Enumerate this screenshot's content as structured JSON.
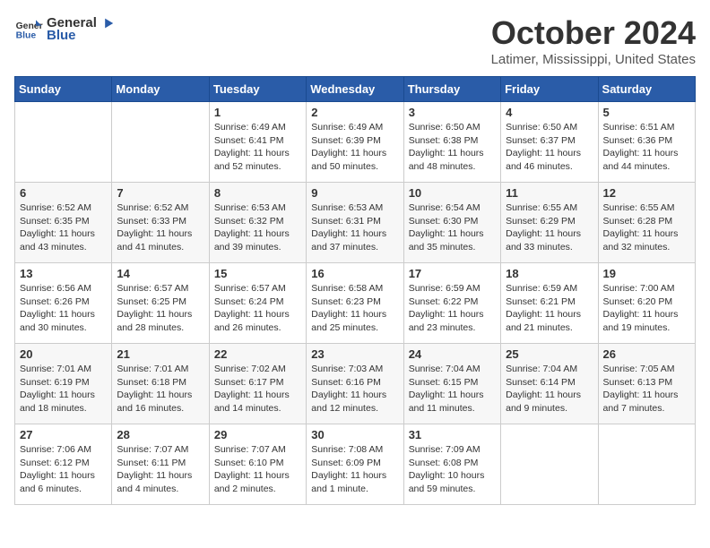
{
  "logo": {
    "general": "General",
    "blue": "Blue"
  },
  "header": {
    "month": "October 2024",
    "location": "Latimer, Mississippi, United States"
  },
  "weekdays": [
    "Sunday",
    "Monday",
    "Tuesday",
    "Wednesday",
    "Thursday",
    "Friday",
    "Saturday"
  ],
  "weeks": [
    [
      {
        "day": "",
        "sunrise": "",
        "sunset": "",
        "daylight": ""
      },
      {
        "day": "",
        "sunrise": "",
        "sunset": "",
        "daylight": ""
      },
      {
        "day": "1",
        "sunrise": "Sunrise: 6:49 AM",
        "sunset": "Sunset: 6:41 PM",
        "daylight": "Daylight: 11 hours and 52 minutes."
      },
      {
        "day": "2",
        "sunrise": "Sunrise: 6:49 AM",
        "sunset": "Sunset: 6:39 PM",
        "daylight": "Daylight: 11 hours and 50 minutes."
      },
      {
        "day": "3",
        "sunrise": "Sunrise: 6:50 AM",
        "sunset": "Sunset: 6:38 PM",
        "daylight": "Daylight: 11 hours and 48 minutes."
      },
      {
        "day": "4",
        "sunrise": "Sunrise: 6:50 AM",
        "sunset": "Sunset: 6:37 PM",
        "daylight": "Daylight: 11 hours and 46 minutes."
      },
      {
        "day": "5",
        "sunrise": "Sunrise: 6:51 AM",
        "sunset": "Sunset: 6:36 PM",
        "daylight": "Daylight: 11 hours and 44 minutes."
      }
    ],
    [
      {
        "day": "6",
        "sunrise": "Sunrise: 6:52 AM",
        "sunset": "Sunset: 6:35 PM",
        "daylight": "Daylight: 11 hours and 43 minutes."
      },
      {
        "day": "7",
        "sunrise": "Sunrise: 6:52 AM",
        "sunset": "Sunset: 6:33 PM",
        "daylight": "Daylight: 11 hours and 41 minutes."
      },
      {
        "day": "8",
        "sunrise": "Sunrise: 6:53 AM",
        "sunset": "Sunset: 6:32 PM",
        "daylight": "Daylight: 11 hours and 39 minutes."
      },
      {
        "day": "9",
        "sunrise": "Sunrise: 6:53 AM",
        "sunset": "Sunset: 6:31 PM",
        "daylight": "Daylight: 11 hours and 37 minutes."
      },
      {
        "day": "10",
        "sunrise": "Sunrise: 6:54 AM",
        "sunset": "Sunset: 6:30 PM",
        "daylight": "Daylight: 11 hours and 35 minutes."
      },
      {
        "day": "11",
        "sunrise": "Sunrise: 6:55 AM",
        "sunset": "Sunset: 6:29 PM",
        "daylight": "Daylight: 11 hours and 33 minutes."
      },
      {
        "day": "12",
        "sunrise": "Sunrise: 6:55 AM",
        "sunset": "Sunset: 6:28 PM",
        "daylight": "Daylight: 11 hours and 32 minutes."
      }
    ],
    [
      {
        "day": "13",
        "sunrise": "Sunrise: 6:56 AM",
        "sunset": "Sunset: 6:26 PM",
        "daylight": "Daylight: 11 hours and 30 minutes."
      },
      {
        "day": "14",
        "sunrise": "Sunrise: 6:57 AM",
        "sunset": "Sunset: 6:25 PM",
        "daylight": "Daylight: 11 hours and 28 minutes."
      },
      {
        "day": "15",
        "sunrise": "Sunrise: 6:57 AM",
        "sunset": "Sunset: 6:24 PM",
        "daylight": "Daylight: 11 hours and 26 minutes."
      },
      {
        "day": "16",
        "sunrise": "Sunrise: 6:58 AM",
        "sunset": "Sunset: 6:23 PM",
        "daylight": "Daylight: 11 hours and 25 minutes."
      },
      {
        "day": "17",
        "sunrise": "Sunrise: 6:59 AM",
        "sunset": "Sunset: 6:22 PM",
        "daylight": "Daylight: 11 hours and 23 minutes."
      },
      {
        "day": "18",
        "sunrise": "Sunrise: 6:59 AM",
        "sunset": "Sunset: 6:21 PM",
        "daylight": "Daylight: 11 hours and 21 minutes."
      },
      {
        "day": "19",
        "sunrise": "Sunrise: 7:00 AM",
        "sunset": "Sunset: 6:20 PM",
        "daylight": "Daylight: 11 hours and 19 minutes."
      }
    ],
    [
      {
        "day": "20",
        "sunrise": "Sunrise: 7:01 AM",
        "sunset": "Sunset: 6:19 PM",
        "daylight": "Daylight: 11 hours and 18 minutes."
      },
      {
        "day": "21",
        "sunrise": "Sunrise: 7:01 AM",
        "sunset": "Sunset: 6:18 PM",
        "daylight": "Daylight: 11 hours and 16 minutes."
      },
      {
        "day": "22",
        "sunrise": "Sunrise: 7:02 AM",
        "sunset": "Sunset: 6:17 PM",
        "daylight": "Daylight: 11 hours and 14 minutes."
      },
      {
        "day": "23",
        "sunrise": "Sunrise: 7:03 AM",
        "sunset": "Sunset: 6:16 PM",
        "daylight": "Daylight: 11 hours and 12 minutes."
      },
      {
        "day": "24",
        "sunrise": "Sunrise: 7:04 AM",
        "sunset": "Sunset: 6:15 PM",
        "daylight": "Daylight: 11 hours and 11 minutes."
      },
      {
        "day": "25",
        "sunrise": "Sunrise: 7:04 AM",
        "sunset": "Sunset: 6:14 PM",
        "daylight": "Daylight: 11 hours and 9 minutes."
      },
      {
        "day": "26",
        "sunrise": "Sunrise: 7:05 AM",
        "sunset": "Sunset: 6:13 PM",
        "daylight": "Daylight: 11 hours and 7 minutes."
      }
    ],
    [
      {
        "day": "27",
        "sunrise": "Sunrise: 7:06 AM",
        "sunset": "Sunset: 6:12 PM",
        "daylight": "Daylight: 11 hours and 6 minutes."
      },
      {
        "day": "28",
        "sunrise": "Sunrise: 7:07 AM",
        "sunset": "Sunset: 6:11 PM",
        "daylight": "Daylight: 11 hours and 4 minutes."
      },
      {
        "day": "29",
        "sunrise": "Sunrise: 7:07 AM",
        "sunset": "Sunset: 6:10 PM",
        "daylight": "Daylight: 11 hours and 2 minutes."
      },
      {
        "day": "30",
        "sunrise": "Sunrise: 7:08 AM",
        "sunset": "Sunset: 6:09 PM",
        "daylight": "Daylight: 11 hours and 1 minute."
      },
      {
        "day": "31",
        "sunrise": "Sunrise: 7:09 AM",
        "sunset": "Sunset: 6:08 PM",
        "daylight": "Daylight: 10 hours and 59 minutes."
      },
      {
        "day": "",
        "sunrise": "",
        "sunset": "",
        "daylight": ""
      },
      {
        "day": "",
        "sunrise": "",
        "sunset": "",
        "daylight": ""
      }
    ]
  ]
}
